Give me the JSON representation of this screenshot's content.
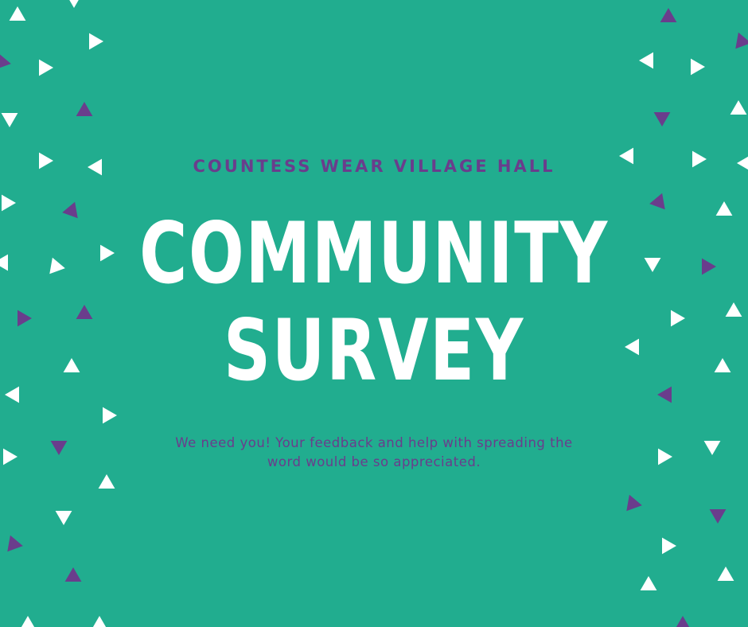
{
  "poster": {
    "organization": "COUNTESS WEAR VILLAGE HALL",
    "headline_line1": "COMMUNITY",
    "headline_line2": "SURVEY",
    "message": "We need you! Your feedback and help with spreading the word would be so appreciated."
  },
  "colors": {
    "background": "#21ad8f",
    "headline": "#ffffff",
    "accent": "#6a3d8c",
    "triangle_light": "#ffffff",
    "triangle_dark": "#6a3d8c"
  },
  "decoration": {
    "pattern": "scattered-triangles"
  }
}
